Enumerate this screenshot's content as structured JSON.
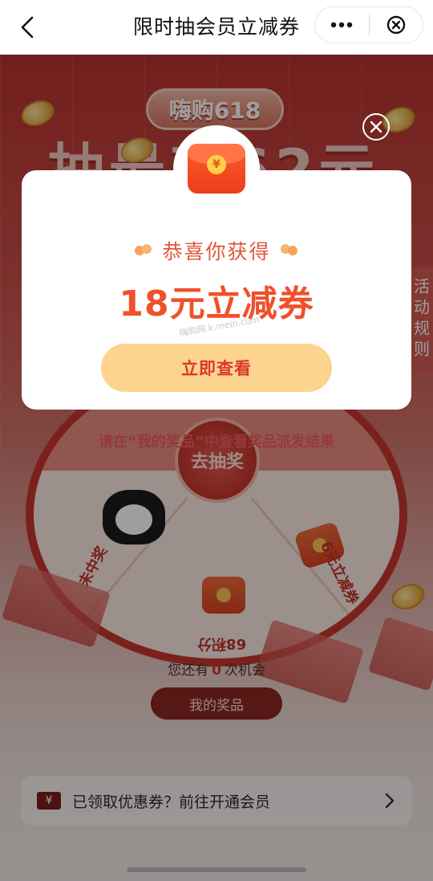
{
  "topbar": {
    "title": "限时抽会员立减券",
    "back_icon": "chevron-left-icon",
    "more_icon": "more-dots-icon",
    "close_icon": "close-circle-icon"
  },
  "background": {
    "badge": "嗨购618",
    "headline": "抽最高62元",
    "side_tab": "活动规则",
    "wheel": {
      "center_button": "去抽奖",
      "segments": [
        "未中奖",
        "68积分",
        "6元立减券"
      ]
    },
    "hint": "请在“我的奖品”中查看奖品派发结果",
    "chances_prefix": "您还有",
    "chances_count": "0",
    "chances_suffix": "次机会",
    "my_prizes_button": "我的奖品",
    "bottom_card": {
      "ticket_symbol": "¥",
      "text": "已领取优惠券？前往开通会员"
    }
  },
  "modal": {
    "icon": "red-envelope-icon",
    "yen": "¥",
    "congrats": "恭喜你获得",
    "prize": "18元立减券",
    "watermark": "嗨购网 k.mein.com",
    "view_button": "立即查看"
  },
  "colors": {
    "accent_red": "#f0502a",
    "button_yellow": "#fdd48e",
    "hint_red": "#f25c62"
  }
}
